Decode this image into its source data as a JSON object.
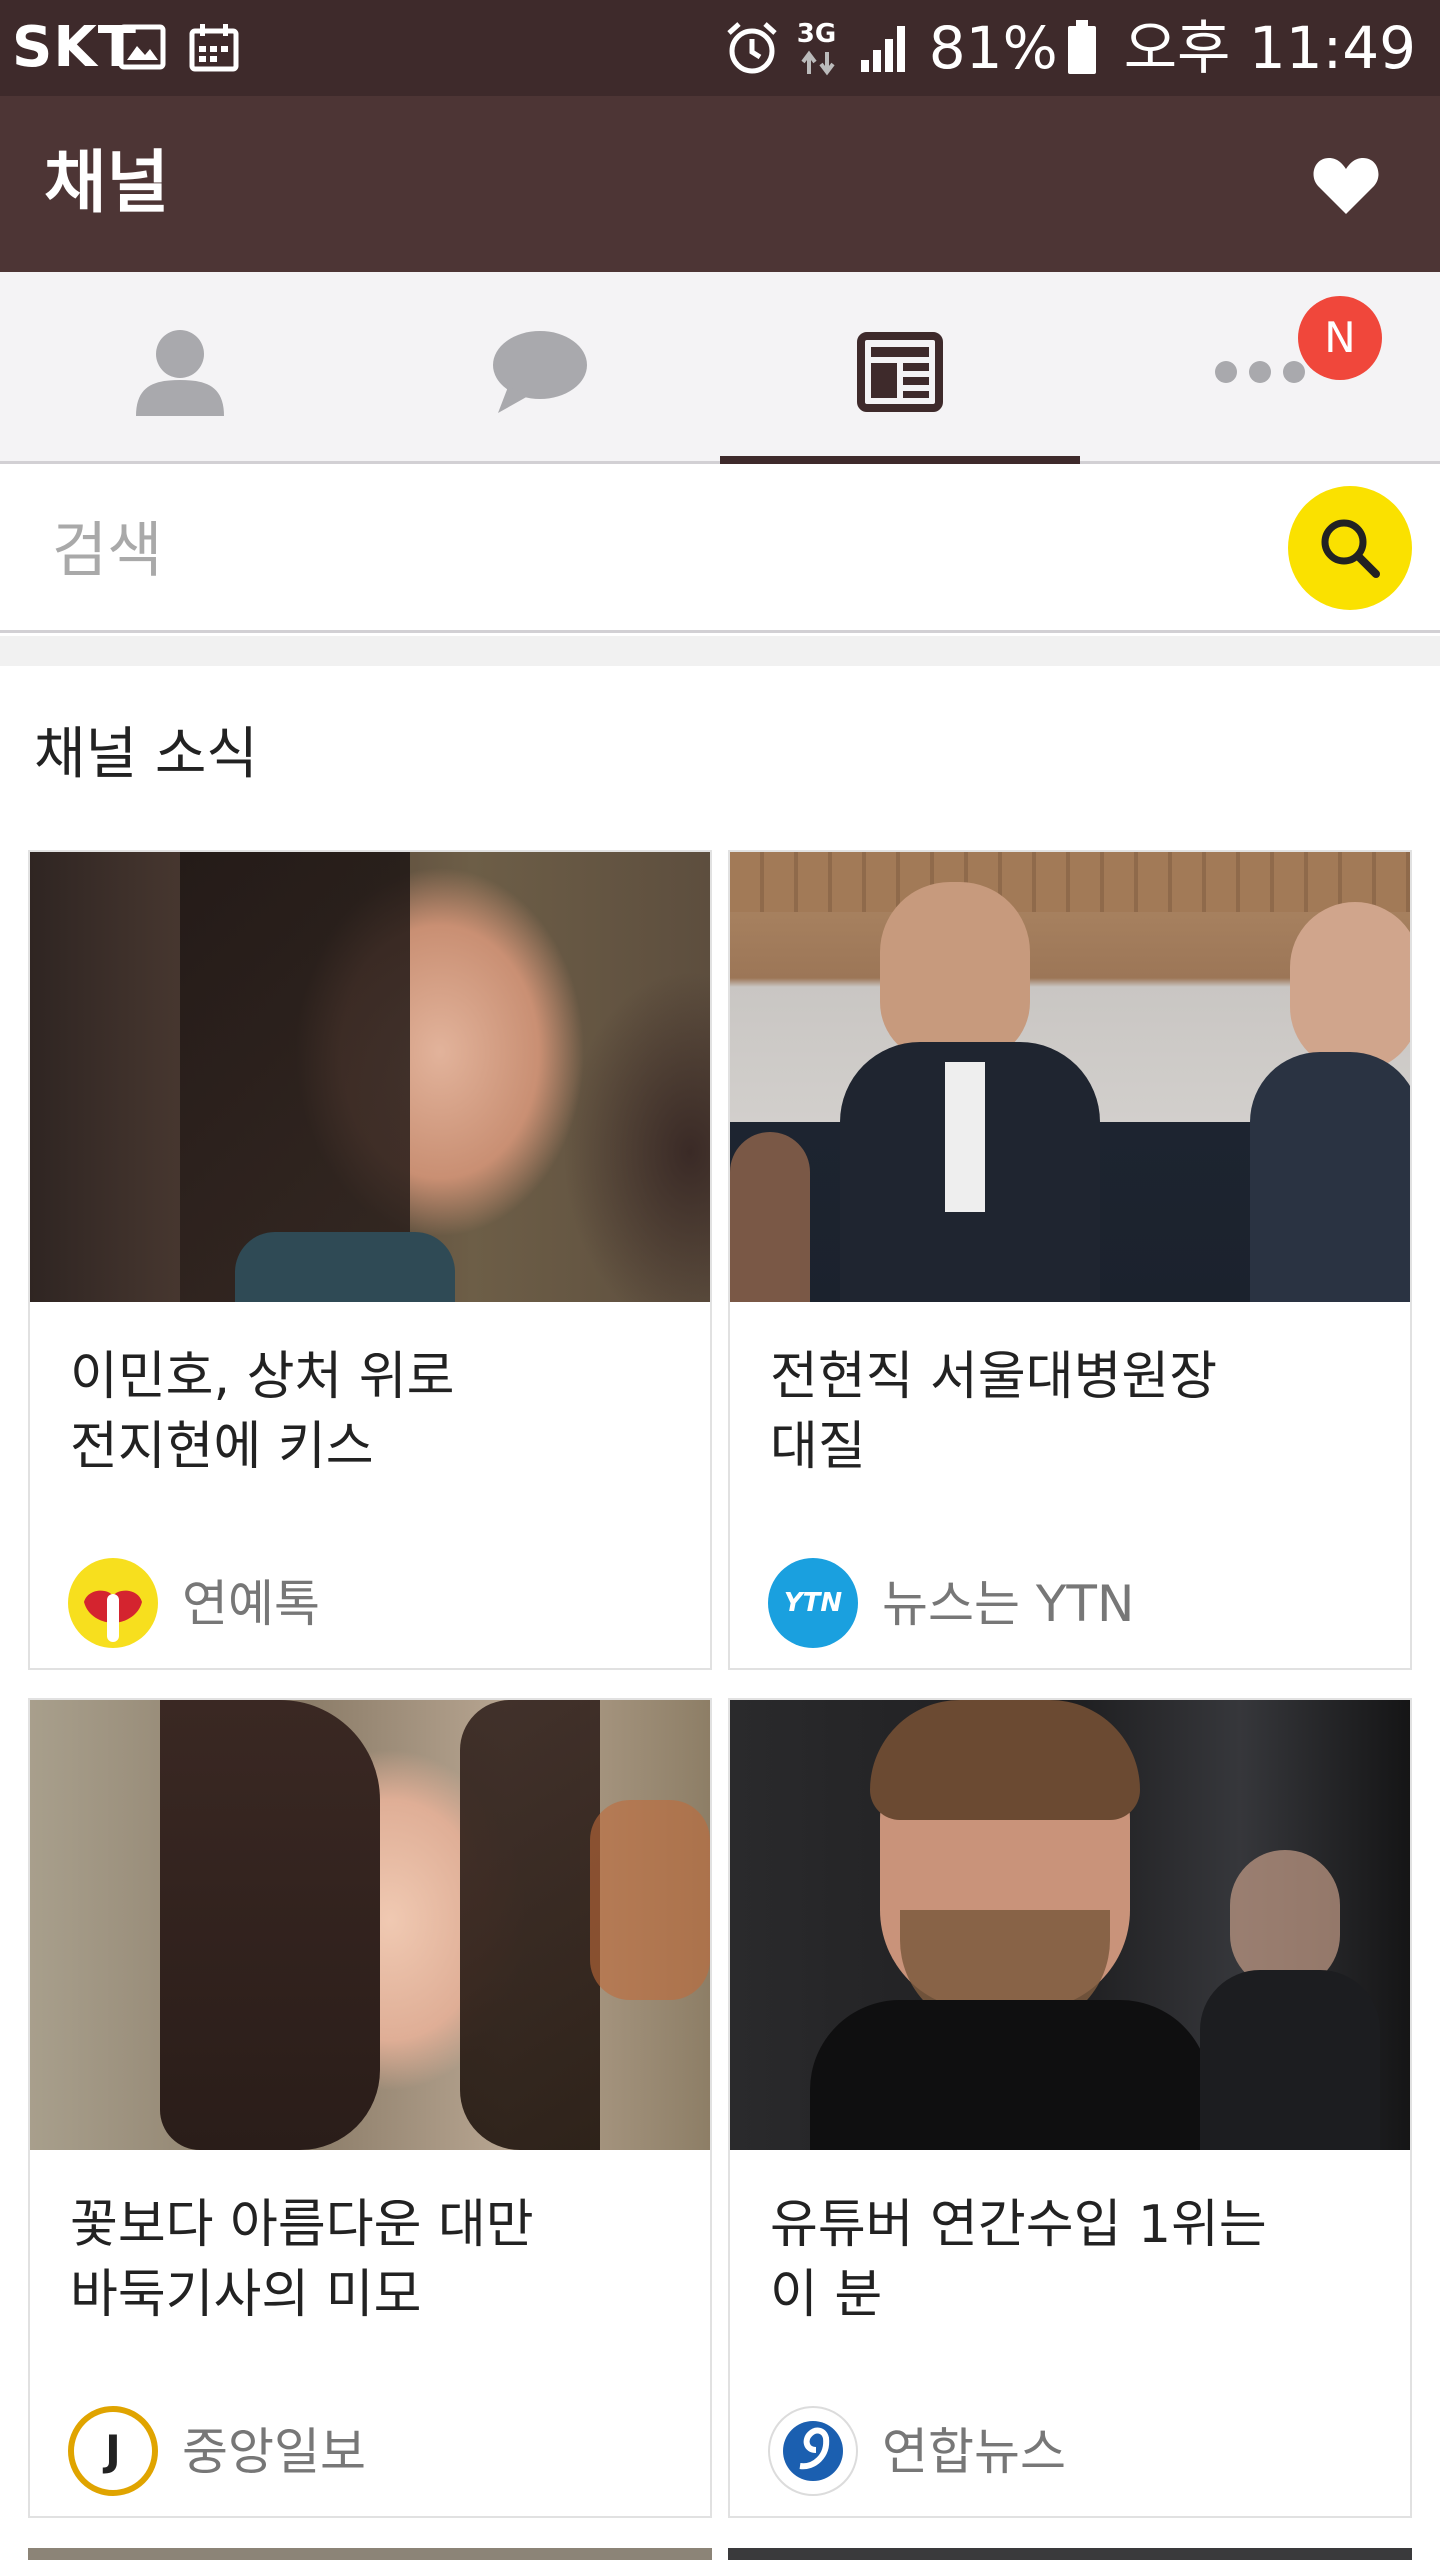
{
  "status_bar": {
    "carrier": "SKT",
    "network": "3G",
    "battery": "81%",
    "time": "오후 11:49",
    "icons": [
      "gallery-icon",
      "calendar-icon",
      "alarm-icon",
      "data-arrows-icon",
      "signal-icon",
      "battery-icon"
    ]
  },
  "app_bar": {
    "title": "채널",
    "heart_icon": "heart-icon"
  },
  "tabs": [
    {
      "name": "friends",
      "icon": "person-icon",
      "active": false
    },
    {
      "name": "chats",
      "icon": "chat-bubble-icon",
      "active": false
    },
    {
      "name": "channel",
      "icon": "news-icon",
      "active": true
    },
    {
      "name": "more",
      "icon": "more-dots-icon",
      "active": false,
      "badge": "N"
    }
  ],
  "search": {
    "placeholder": "검색",
    "button_icon": "search-icon",
    "button_color": "#fae100"
  },
  "section": {
    "title": "채널 소식"
  },
  "cards": [
    {
      "title": "이민호, 상처 위로\n전지현에 키스",
      "source": "연예톡",
      "logo": "yeonyetok-logo"
    },
    {
      "title": "전현직 서울대병원장\n대질",
      "source": "뉴스는 YTN",
      "logo": "ytn-logo",
      "logo_text": "YTN"
    },
    {
      "title": "꽃보다 아름다운 대만\n바둑기사의 미모",
      "source": "중앙일보",
      "logo": "joongang-logo",
      "logo_text": "J"
    },
    {
      "title": "유튜버 연간수입 1위는\n이 분",
      "source": "연합뉴스",
      "logo": "yonhap-logo"
    }
  ],
  "colors": {
    "status_bar": "#3e2a2b",
    "app_bar": "#4d3535",
    "tab_bar": "#f4f3f5",
    "badge": "#f0473b",
    "accent_yellow": "#fae100"
  }
}
